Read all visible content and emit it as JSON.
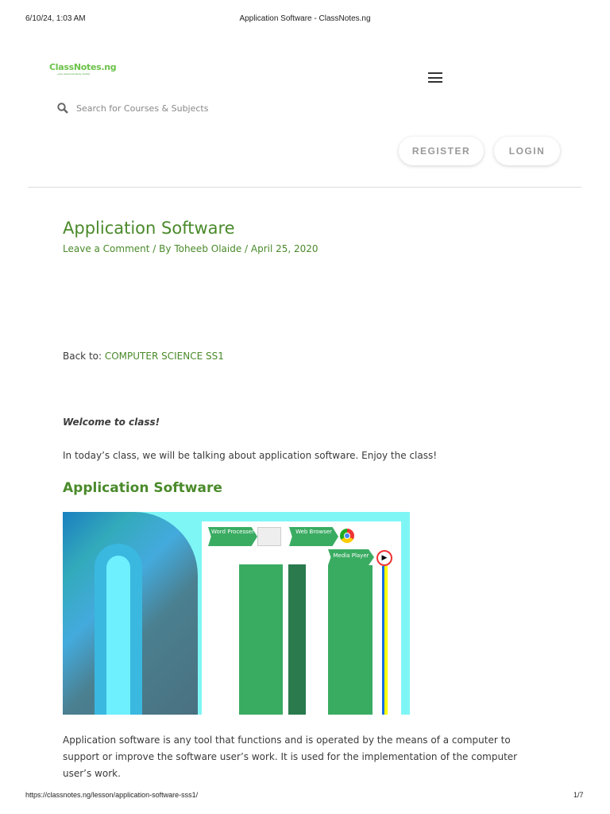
{
  "print_header": {
    "datetime": "6/10/24, 1:03 AM",
    "page_title": "Application Software - ClassNotes.ng"
  },
  "logo": {
    "name": "ClassNotes.ng",
    "tagline": "...your personal study buddy"
  },
  "search": {
    "placeholder": "Search for Courses & Subjects",
    "icon": "search-icon"
  },
  "buttons": {
    "register": "REGISTER",
    "login": "LOGIN"
  },
  "article": {
    "title": "Application Software",
    "comment_link": "Leave a Comment",
    "by": " / By ",
    "author": "Toheeb Olaide",
    "sep": " / ",
    "date": "April 25, 2020",
    "back_prefix": "Back to: ",
    "back_link": "COMPUTER SCIENCE SS1",
    "welcome": "Welcome to class!",
    "intro": "In today’s class, we will be talking about application software. Enjoy the class!",
    "heading": "Application Software",
    "image_labels": {
      "word": "Word Processer",
      "web": "Web Browser",
      "media": "Media Player"
    },
    "para1": "Application software is any tool that functions and is operated by the means of a computer to support or improve the software user’s work. It is used for the implementation of the computer user’s work."
  },
  "print_footer": {
    "url": "https://classnotes.ng/lesson/application-software-sss1/",
    "page": "1/7"
  }
}
